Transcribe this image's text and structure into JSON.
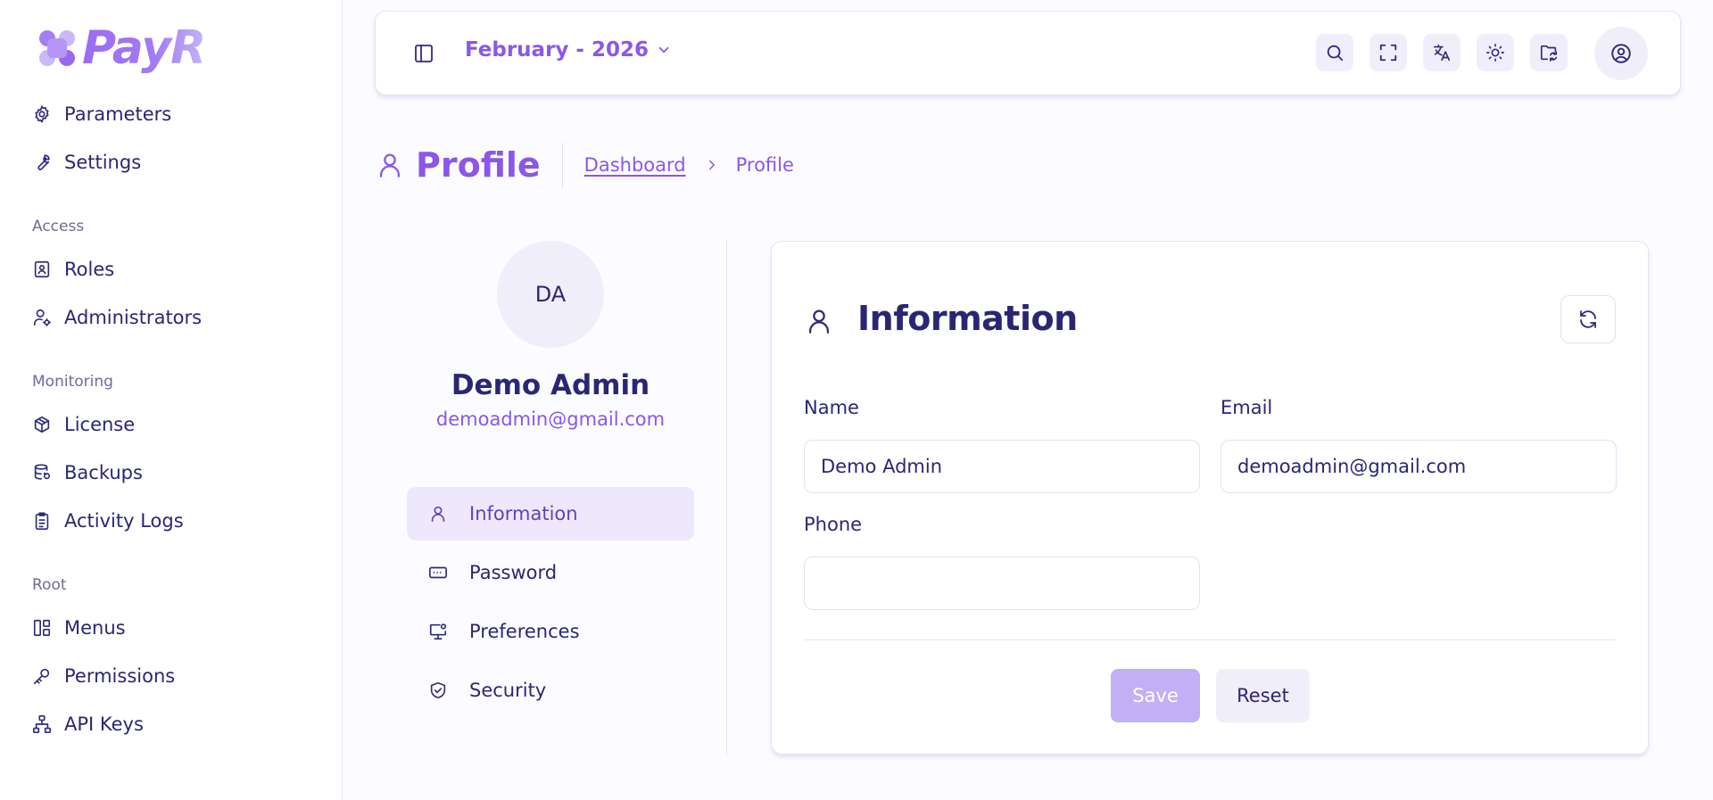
{
  "brand": {
    "name": "PayR",
    "accent": "#8a57ea",
    "text": "#2b2673"
  },
  "sidebar": {
    "items_top": [
      {
        "label": "Parameters",
        "icon": "gear-icon"
      },
      {
        "label": "Settings",
        "icon": "wrench-icon"
      }
    ],
    "sections": [
      {
        "title": "Access",
        "items": [
          {
            "label": "Roles",
            "icon": "role-badge-icon"
          },
          {
            "label": "Administrators",
            "icon": "user-gear-icon"
          }
        ]
      },
      {
        "title": "Monitoring",
        "items": [
          {
            "label": "License",
            "icon": "package-icon"
          },
          {
            "label": "Backups",
            "icon": "database-restore-icon"
          },
          {
            "label": "Activity Logs",
            "icon": "clipboard-list-icon"
          }
        ]
      },
      {
        "title": "Root",
        "items": [
          {
            "label": "Menus",
            "icon": "layout-panels-icon"
          },
          {
            "label": "Permissions",
            "icon": "key-icon"
          },
          {
            "label": "API Keys",
            "icon": "network-icon"
          }
        ]
      }
    ]
  },
  "topbar": {
    "period": "February - 2026",
    "icons": [
      "sidebar-toggle-icon",
      "search-icon",
      "fullscreen-icon",
      "translate-icon",
      "sun-icon",
      "folder-sync-icon",
      "user-circle-icon"
    ]
  },
  "page": {
    "title": "Profile",
    "breadcrumb": {
      "link": "Dashboard",
      "current": "Profile"
    }
  },
  "profile": {
    "initials": "DA",
    "name": "Demo Admin",
    "email": "demoadmin@gmail.com",
    "tabs": [
      {
        "label": "Information",
        "icon": "user-icon",
        "active": true
      },
      {
        "label": "Password",
        "icon": "password-dots-icon",
        "active": false
      },
      {
        "label": "Preferences",
        "icon": "monitor-settings-icon",
        "active": false
      },
      {
        "label": "Security",
        "icon": "shield-check-icon",
        "active": false
      }
    ]
  },
  "info_card": {
    "title": "Information",
    "fields": {
      "name": {
        "label": "Name",
        "value": "Demo Admin"
      },
      "email": {
        "label": "Email",
        "value": "demoadmin@gmail.com"
      },
      "phone": {
        "label": "Phone",
        "value": ""
      }
    },
    "save_label": "Save",
    "reset_label": "Reset"
  }
}
